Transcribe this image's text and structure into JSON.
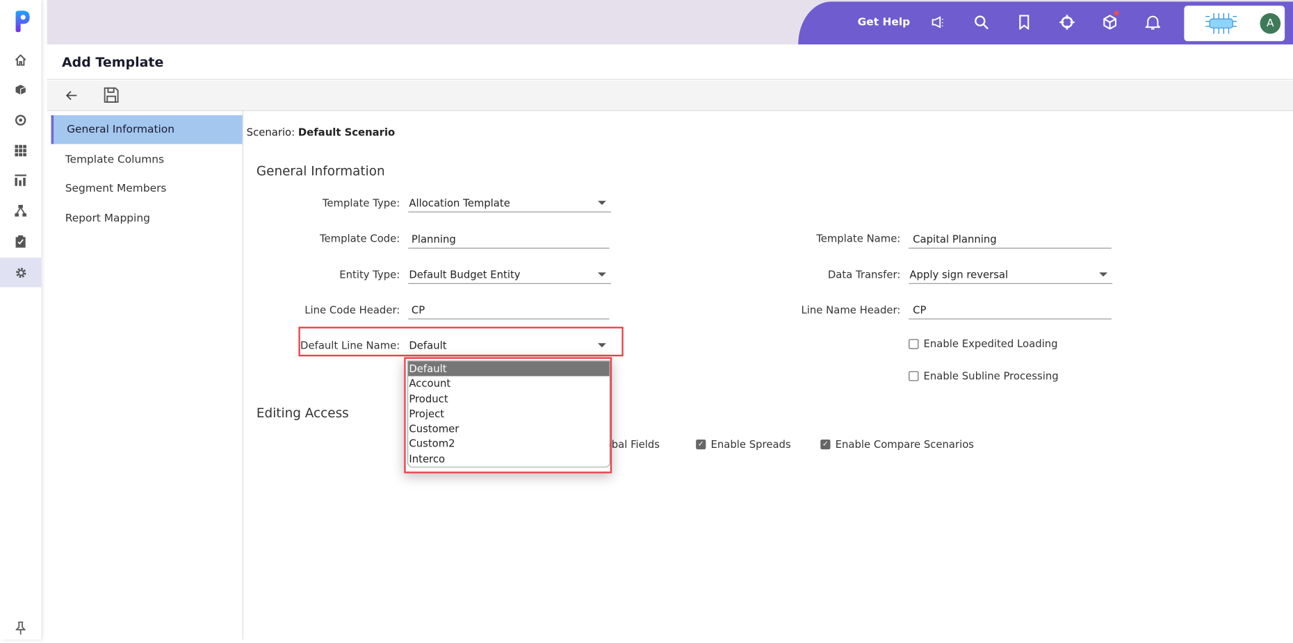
{
  "topbar": {
    "get_help": "Get Help",
    "avatar_initial": "A",
    "accent": "#6f5ccf",
    "icons": [
      "megaphone-icon",
      "search-icon",
      "bookmark-icon",
      "crosshair-icon",
      "cube-icon",
      "bell-icon"
    ]
  },
  "rail": {
    "icons": [
      "home-icon",
      "cube-icon",
      "target-icon",
      "grid-icon",
      "report-icon",
      "hierarchy-icon",
      "clipboard-check-icon",
      "gear-icon"
    ],
    "active": "gear-icon"
  },
  "page": {
    "title": "Add Template"
  },
  "nav": {
    "items": [
      {
        "label": "General Information",
        "active": true
      },
      {
        "label": "Template Columns"
      },
      {
        "label": "Segment Members"
      },
      {
        "label": "Report Mapping"
      }
    ]
  },
  "scenario": {
    "label": "Scenario:",
    "value": "Default Scenario"
  },
  "general": {
    "heading": "General Information",
    "template_type": {
      "label": "Template Type:",
      "value": "Allocation Template"
    },
    "template_code": {
      "label": "Template Code:",
      "value": "Planning"
    },
    "template_name": {
      "label": "Template Name:",
      "value": "Capital Planning"
    },
    "entity_type": {
      "label": "Entity Type:",
      "value": "Default Budget Entity"
    },
    "data_transfer": {
      "label": "Data Transfer:",
      "value": "Apply sign reversal"
    },
    "line_code_header": {
      "label": "Line Code Header:",
      "value": "CP"
    },
    "line_name_header": {
      "label": "Line Name Header:",
      "value": "CP"
    },
    "default_line_name": {
      "label": "Default Line Name:",
      "value": "Default",
      "options": [
        "Default",
        "Account",
        "Product",
        "Project",
        "Customer",
        "Custom2",
        "Interco"
      ]
    },
    "expedited_loading": {
      "label": "Enable Expedited Loading",
      "checked": false
    },
    "subline_processing": {
      "label": "Enable Subline Processing",
      "checked": false
    }
  },
  "editing": {
    "heading": "Editing Access",
    "global_fields": {
      "label": "obal Fields"
    },
    "spreads": {
      "label": "Enable Spreads",
      "checked": true
    },
    "compare": {
      "label": "Enable Compare Scenarios",
      "checked": true
    }
  }
}
